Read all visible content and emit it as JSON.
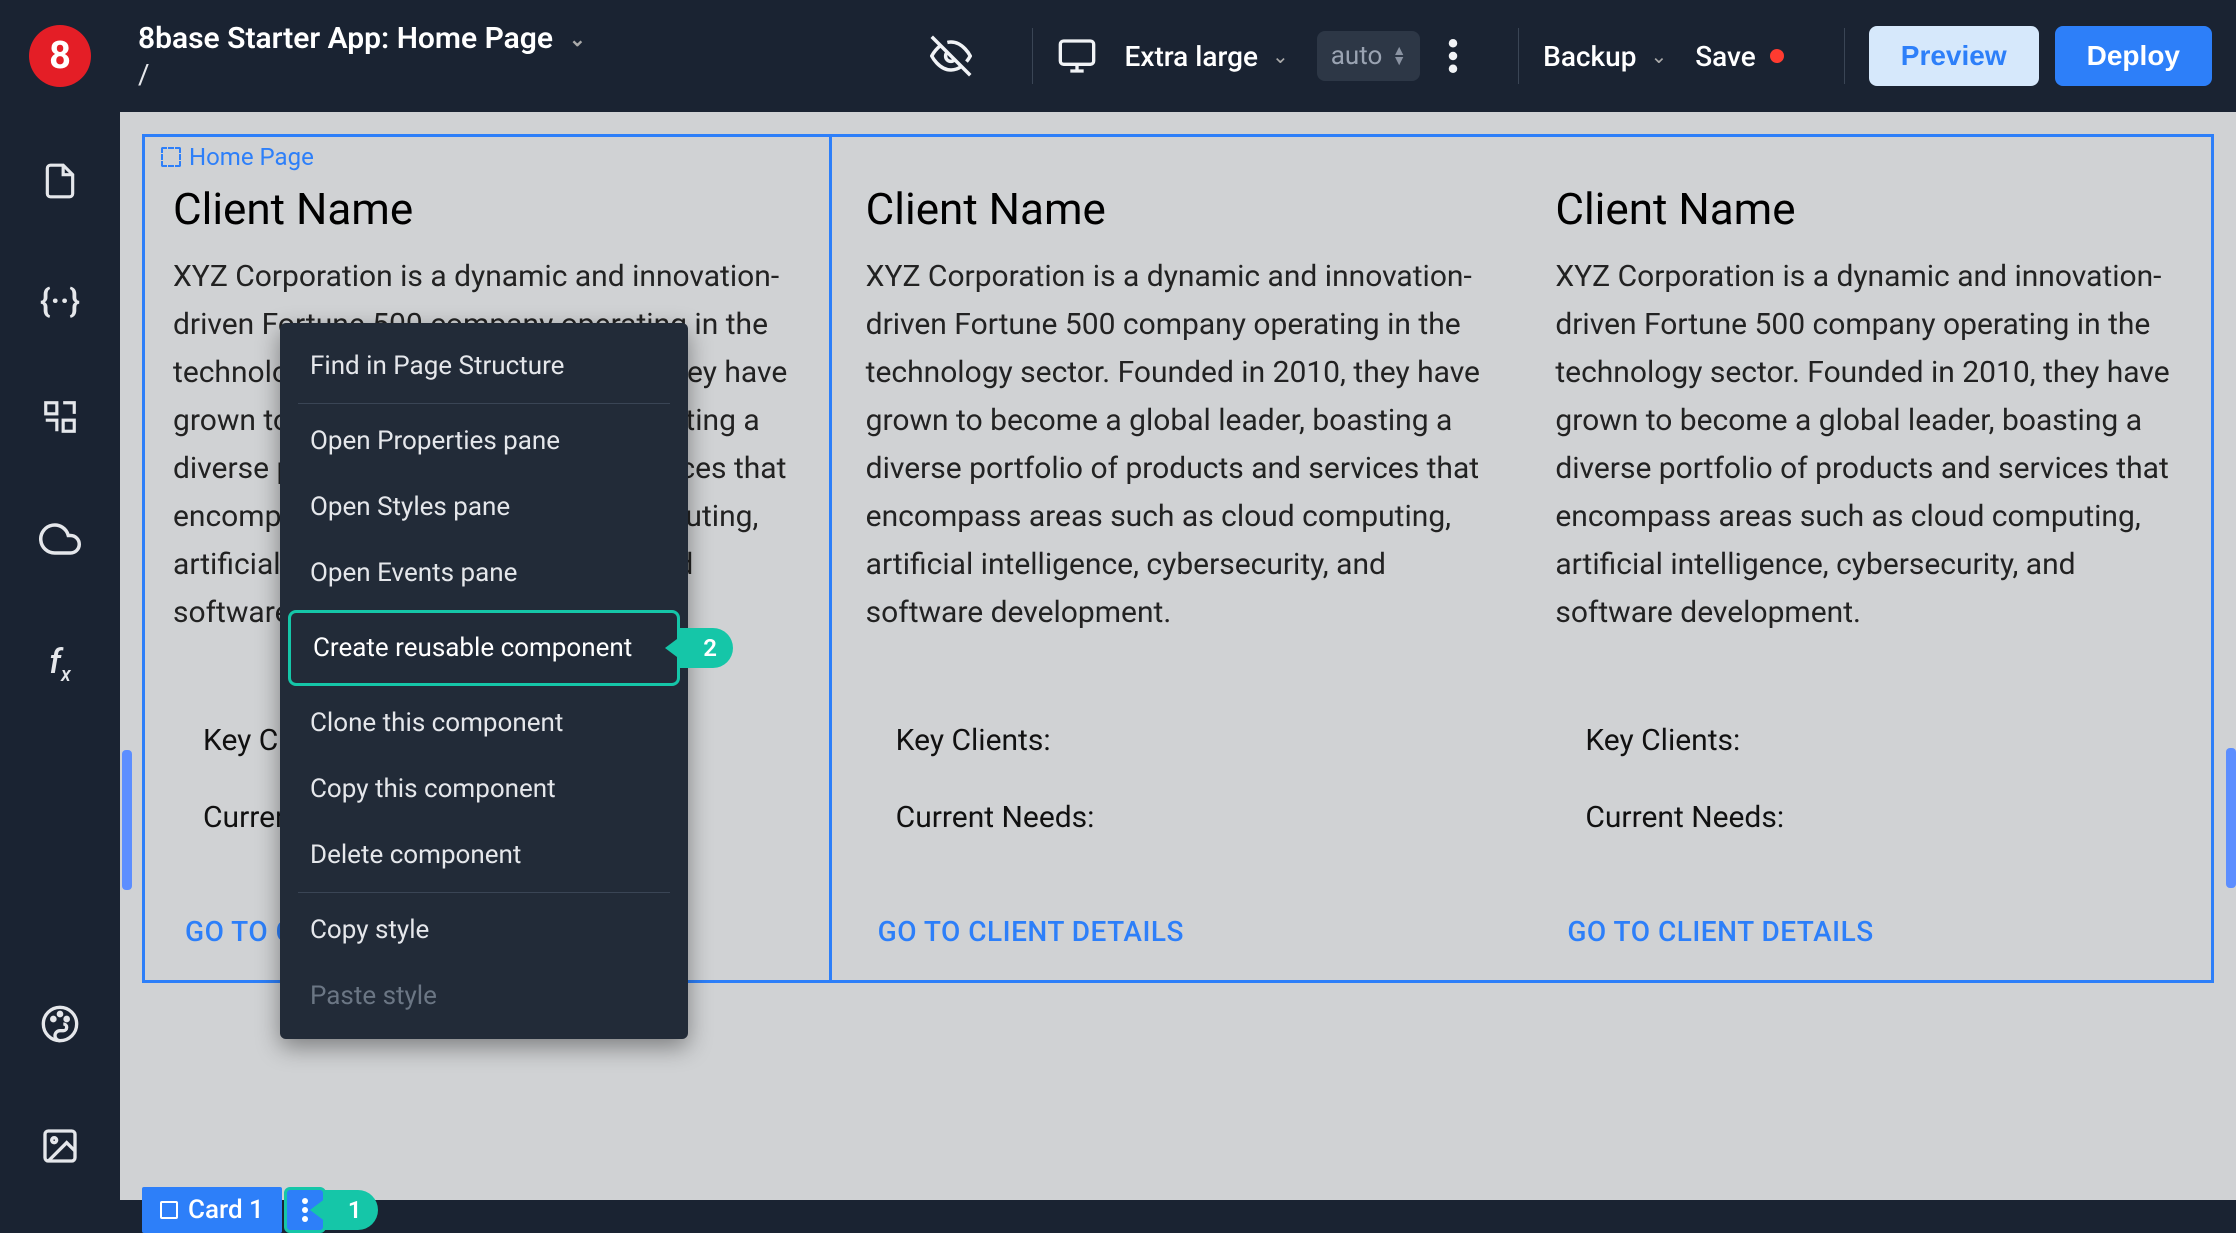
{
  "brand": {
    "logo_text": "8"
  },
  "header": {
    "app_title": "8base Starter App: Home Page",
    "route_path": "/",
    "viewport_label": "Extra large",
    "zoom_mode": "auto",
    "backup_label": "Backup",
    "save_label": "Save",
    "preview_label": "Preview",
    "deploy_label": "Deploy"
  },
  "breadcrumb": {
    "label": "Home Page"
  },
  "cards": [
    {
      "title": "Client Name",
      "desc": "XYZ Corporation is a dynamic and innovation-driven Fortune 500 company operating in the technology sector. Founded in 2010, they have grown to become a global leader, boasting a diverse portfolio of products and services that encompass areas such as cloud computing, artificial intelligence, cybersecurity, and software development.",
      "key_clients_label": "Key Clients:",
      "current_needs_label": "Current Needs:",
      "detail_link": "GO TO CLIENT DETAILS"
    },
    {
      "title": "Client Name",
      "desc": "XYZ Corporation is a dynamic and innovation-driven Fortune 500 company operating in the technology sector. Founded in 2010, they have grown to become a global leader, boasting a diverse portfolio of products and services that encompass areas such as cloud computing, artificial intelligence, cybersecurity, and software development.",
      "key_clients_label": "Key Clients:",
      "current_needs_label": "Current Needs:",
      "detail_link": "GO TO CLIENT DETAILS"
    },
    {
      "title": "Client Name",
      "desc": "XYZ Corporation is a dynamic and innovation-driven Fortune 500 company operating in the technology sector. Founded in 2010, they have grown to become a global leader, boasting a diverse portfolio of products and services that encompass areas such as cloud computing, artificial intelligence, cybersecurity, and software development.",
      "key_clients_label": "Key Clients:",
      "current_needs_label": "Current Needs:",
      "detail_link": "GO TO CLIENT DETAILS"
    }
  ],
  "selected_component": {
    "label": "Card 1"
  },
  "annotations": {
    "step1": "1",
    "step2": "2"
  },
  "context_menu": {
    "items": [
      {
        "label": "Find in Page Structure"
      },
      {
        "label": "Open Properties pane"
      },
      {
        "label": "Open Styles pane"
      },
      {
        "label": "Open Events pane"
      },
      {
        "label": "Create reusable component",
        "highlighted": true
      },
      {
        "label": "Clone this component"
      },
      {
        "label": "Copy this component"
      },
      {
        "label": "Delete component"
      },
      {
        "label": "Copy style"
      },
      {
        "label": "Paste style",
        "disabled": true
      }
    ]
  }
}
